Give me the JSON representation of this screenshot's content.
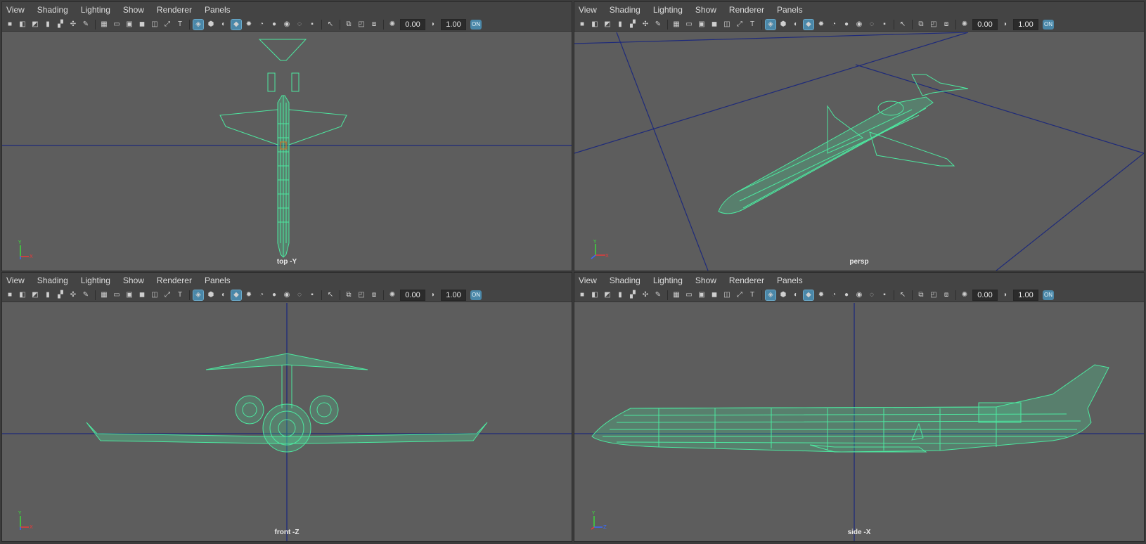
{
  "menu": [
    "View",
    "Shading",
    "Lighting",
    "Show",
    "Renderer",
    "Panels"
  ],
  "toolbar": {
    "icons": [
      "camera-icon",
      "camera-attributes-icon",
      "camera-motion-icon",
      "bookmark-icon",
      "image-plane-icon",
      "xray-icon",
      "grease-pencil-icon",
      "grid-icon",
      "film-gate-icon",
      "resolution-gate-icon",
      "gate-mask-icon",
      "field-chart-icon",
      "safe-action-icon",
      "safe-title-icon",
      "wireframe-icon",
      "smooth-shade-icon",
      "flat-shade-icon",
      "textured-icon",
      "lights-icon",
      "shadows-icon",
      "screen-space-ao-icon",
      "motion-blur-icon",
      "anti-alias-icon",
      "depth-of-field-icon",
      "isolate-select-icon",
      "xray-joints-icon",
      "xray-active-icon",
      "backface-icon",
      "exposure-icon",
      "gamma-icon"
    ],
    "exposure_value": "0.00",
    "gamma_value": "1.00",
    "color_mgmt_label": "ON"
  },
  "panels": [
    {
      "camera": "top -Y",
      "axes": [
        "Y",
        "X",
        "Z"
      ]
    },
    {
      "camera": "persp",
      "axes": [
        "Y",
        "X",
        "Z"
      ]
    },
    {
      "camera": "front -Z",
      "axes": [
        "Y",
        "X",
        "Z"
      ]
    },
    {
      "camera": "side -X",
      "axes": [
        "Y",
        "X",
        "Z"
      ]
    }
  ],
  "colors": {
    "wireframe": "#4de8a0",
    "grid_line": "#1e2a7a",
    "background": "#5d5d5d",
    "active_icon": "#4a87a8"
  }
}
